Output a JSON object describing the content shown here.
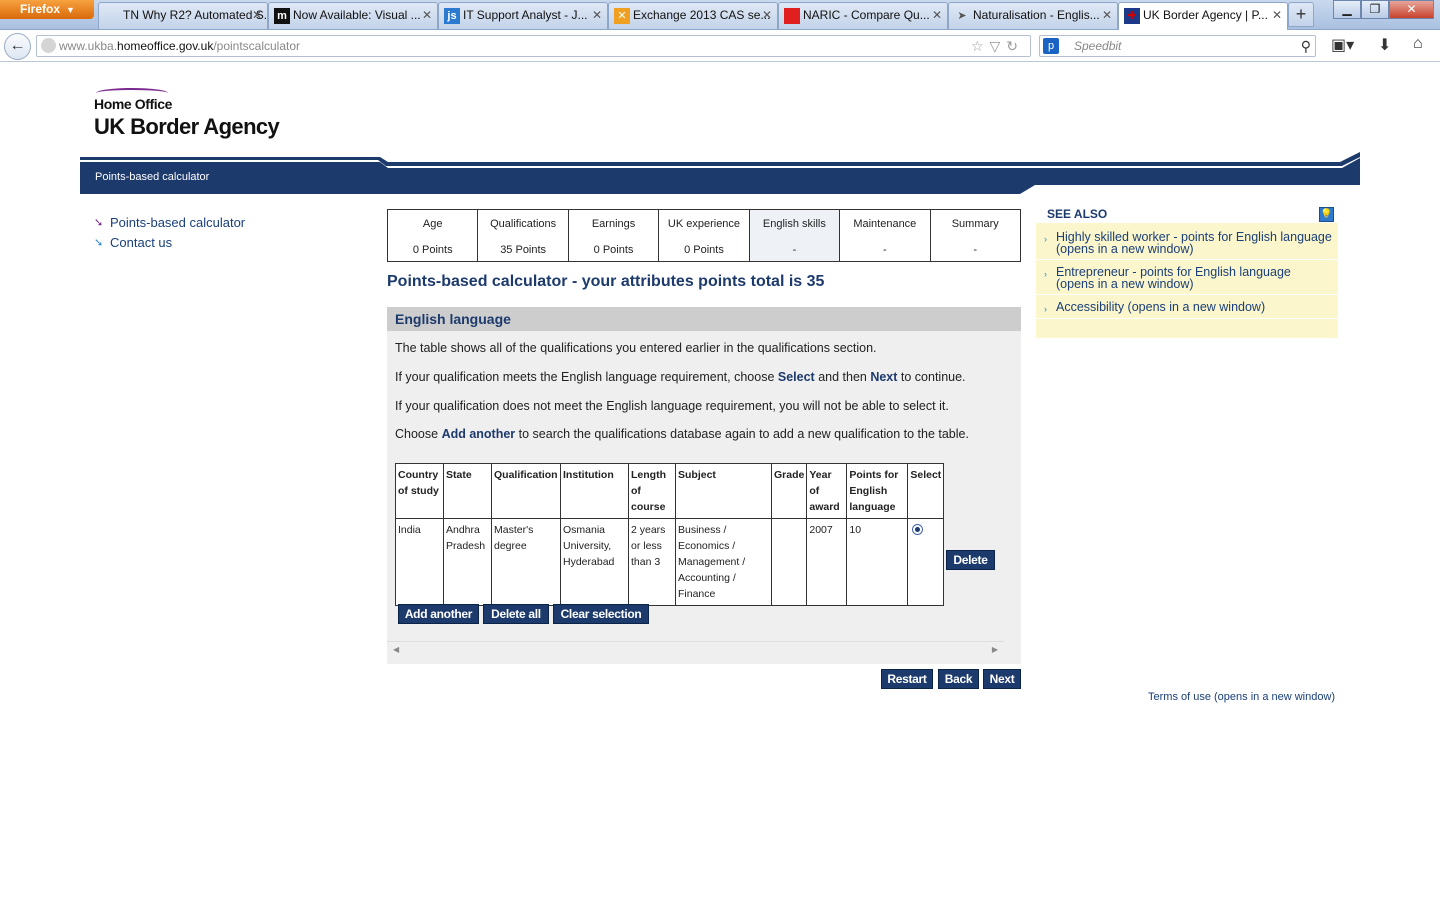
{
  "browser": {
    "app_button": "Firefox",
    "tabs": [
      {
        "label": "TN Why R2? Automated S...",
        "icon": "tn-icon"
      },
      {
        "label": "Now Available: Visual ...",
        "icon": "m-icon"
      },
      {
        "label": "IT Support Analyst - J...",
        "icon": "js-icon"
      },
      {
        "label": "Exchange 2013 CAS se...",
        "icon": "exchange-icon"
      },
      {
        "label": "NARIC - Compare Qu...",
        "icon": "naric-icon"
      },
      {
        "label": "Naturalisation - Englis...",
        "icon": "ukba-icon"
      },
      {
        "label": "UK Border Agency | P...",
        "icon": "union-flag-icon"
      }
    ],
    "url_prefix": "www.ukba.",
    "url_domain": "homeoffice.gov.uk",
    "url_path": "/pointscalculator",
    "search_placeholder": "Speedbit"
  },
  "logo": {
    "home_office": "Home Office",
    "agency": "UK Border Agency"
  },
  "banner": {
    "breadcrumb": "Points-based calculator",
    "navy": "#1d3a6d"
  },
  "leftnav": {
    "items": [
      "Points-based calculator",
      "Contact us"
    ]
  },
  "steps": [
    {
      "label": "Age",
      "points": "0 Points"
    },
    {
      "label": "Qualifications",
      "points": "35 Points"
    },
    {
      "label": "Earnings",
      "points": "0 Points"
    },
    {
      "label": "UK experience",
      "points": "0 Points"
    },
    {
      "label": "English skills",
      "points": "-"
    },
    {
      "label": "Maintenance",
      "points": "-"
    },
    {
      "label": "Summary",
      "points": "-"
    }
  ],
  "main": {
    "heading": "Points-based calculator - your attributes points total is 35",
    "section_title": "English language",
    "p1": "The table shows all of the qualifications you entered earlier in the qualifications section.",
    "p2_a": "If your qualification meets the English language requirement, choose ",
    "p2_b": "Select",
    "p2_c": " and then ",
    "p2_d": "Next",
    "p2_e": " to continue.",
    "p3": "If your qualification does not meet the English language requirement, you will not be able to select it.",
    "p4_a": "Choose ",
    "p4_b": "Add another",
    "p4_c": " to search the qualifications database again to add a new qualification to the table."
  },
  "table": {
    "headers": [
      "Country of study",
      "State",
      "Qualification",
      "Institution",
      "Length of course",
      "Subject",
      "Grade",
      "Year of award",
      "Points for English language",
      "Select"
    ],
    "row": [
      "India",
      "Andhra Pradesh",
      "Master's degree",
      "Osmania University, Hyderabad",
      "2 years or less than 3",
      "Business / Economics / Management / Accounting / Finance",
      "",
      "2007",
      "10"
    ]
  },
  "buttons": {
    "delete": "Delete",
    "add_another": "Add another",
    "delete_all": "Delete all",
    "clear_selection": "Clear selection",
    "restart": "Restart",
    "back": "Back",
    "next": "Next"
  },
  "see_also": {
    "title": "SEE ALSO",
    "items": [
      "Highly skilled worker - points for English language (opens in a new window)",
      "Entrepreneur - points for English language (opens in a new window)",
      "Accessibility (opens in a new window)"
    ]
  },
  "footer": {
    "terms": "Terms of use (opens in a new window)"
  }
}
